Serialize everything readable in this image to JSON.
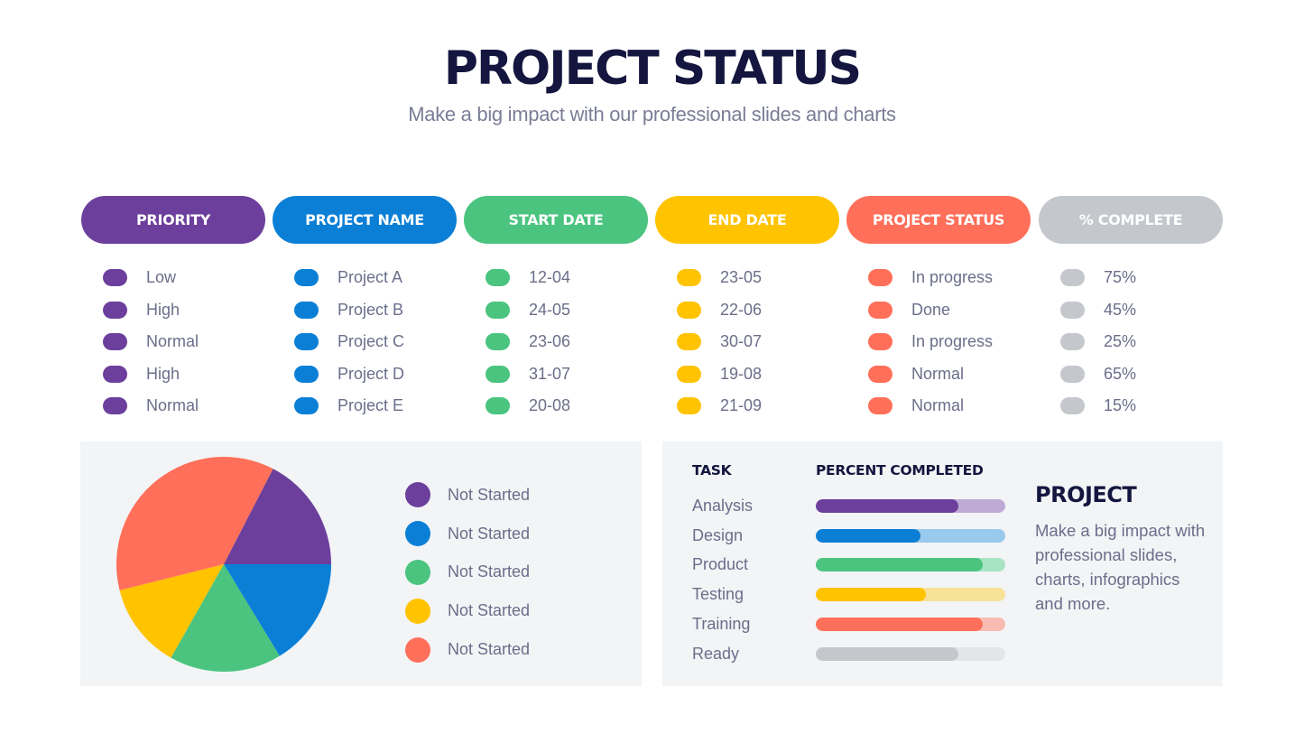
{
  "header": {
    "title": "PROJECT STATUS",
    "subtitle": "Make a big impact with our professional slides and charts"
  },
  "colors": {
    "purple": "#6c3f9c",
    "blue": "#0b7fd6",
    "green": "#4ac47f",
    "yellow": "#ffc300",
    "red": "#ff6f59",
    "gray": "#c4c7cc",
    "purple_light": "#bfaad5",
    "blue_light": "#99c9ec",
    "green_light": "#a8e4c2",
    "yellow_light": "#f8e199",
    "red_light": "#f8bcb2",
    "gray_light": "#e3e5e8"
  },
  "table": {
    "columns": [
      {
        "header": "PRIORITY",
        "color": "#6c3f9c",
        "values": [
          "Low",
          "High",
          "Normal",
          "High",
          "Normal"
        ]
      },
      {
        "header": "PROJECT NAME",
        "color": "#0b7fd6",
        "values": [
          "Project A",
          "Project B",
          "Project C",
          "Project D",
          "Project E"
        ]
      },
      {
        "header": "START DATE",
        "color": "#4ac47f",
        "values": [
          "12-04",
          "24-05",
          "23-06",
          "31-07",
          "20-08"
        ]
      },
      {
        "header": "END DATE",
        "color": "#ffc300",
        "values": [
          "23-05",
          "22-06",
          "30-07",
          "19-08",
          "21-09"
        ]
      },
      {
        "header": "PROJECT STATUS",
        "color": "#ff6f59",
        "values": [
          "In progress",
          "Done",
          "In progress",
          "Normal",
          "Normal"
        ]
      },
      {
        "header": "% COMPLETE",
        "color": "#c4c7cc",
        "values": [
          "75%",
          "45%",
          "25%",
          "65%",
          "15%"
        ]
      }
    ]
  },
  "tasks": {
    "task_header": "TASK",
    "percent_header": "PERCENT COMPLETED",
    "items": [
      {
        "name": "Analysis",
        "percent": 75,
        "color": "#6c3f9c",
        "track": "#bfaad5"
      },
      {
        "name": "Design",
        "percent": 55,
        "color": "#0b7fd6",
        "track": "#99c9ec"
      },
      {
        "name": "Product",
        "percent": 88,
        "color": "#4ac47f",
        "track": "#a8e4c2"
      },
      {
        "name": "Testing",
        "percent": 58,
        "color": "#ffc300",
        "track": "#f8e199"
      },
      {
        "name": "Training",
        "percent": 88,
        "color": "#ff6f59",
        "track": "#f8bcb2"
      },
      {
        "name": "Ready",
        "percent": 75,
        "color": "#c4c7cc",
        "track": "#e3e5e8"
      }
    ]
  },
  "side": {
    "title": "PROJECT",
    "text": "Make a big impact with professional slides, charts, infographics and more."
  },
  "chart_data": [
    {
      "type": "pie",
      "title": "",
      "legend_position": "right",
      "start_angle_deg": 0,
      "direction": "counterclockwise-from-east for first slice",
      "slices": [
        {
          "label": "Not Started",
          "value": 17.4,
          "color": "#6c3f9c"
        },
        {
          "label": "Not Started",
          "value": 16.3,
          "color": "#0b7fd6"
        },
        {
          "label": "Not Started",
          "value": 16.9,
          "color": "#4ac47f"
        },
        {
          "label": "Not Started",
          "value": 12.9,
          "color": "#ffc300"
        },
        {
          "label": "Not Started",
          "value": 36.5,
          "color": "#ff6f59"
        }
      ]
    },
    {
      "type": "bar",
      "orientation": "horizontal",
      "title": "PERCENT COMPLETED",
      "categories": [
        "Analysis",
        "Design",
        "Product",
        "Testing",
        "Training",
        "Ready"
      ],
      "values": [
        75,
        55,
        88,
        58,
        88,
        75
      ],
      "xlim": [
        0,
        100
      ]
    }
  ]
}
